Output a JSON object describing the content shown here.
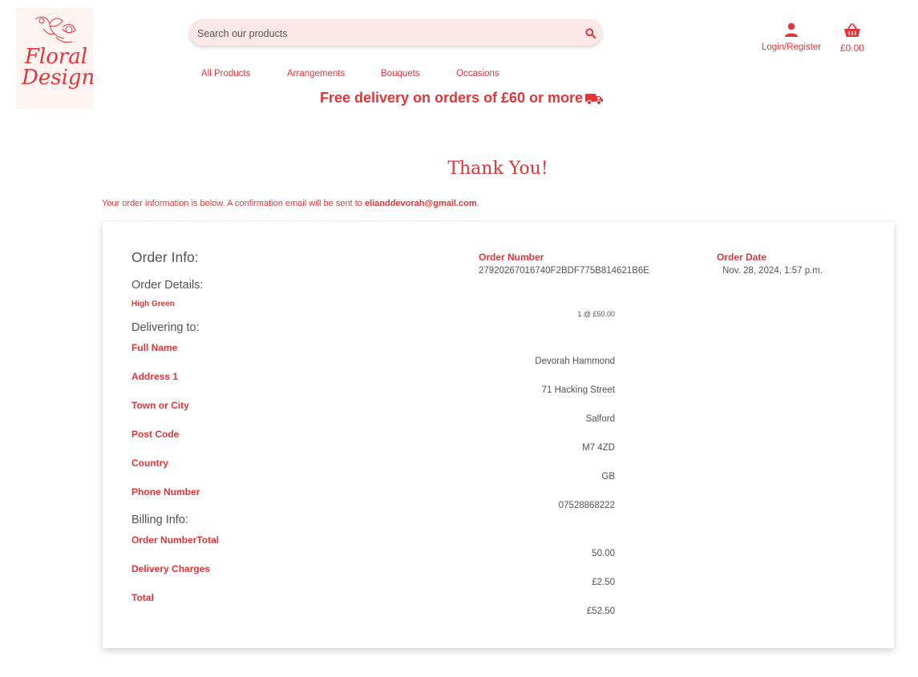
{
  "brand": {
    "logo_text_line1": "Floral",
    "logo_text_line2": "Design"
  },
  "search": {
    "placeholder": "Search our products"
  },
  "nav": {
    "items": [
      {
        "label": "All Products"
      },
      {
        "label": "Arrangements"
      },
      {
        "label": "Bouquets"
      },
      {
        "label": "Occasions"
      }
    ]
  },
  "promo": {
    "text": "Free delivery on orders of £60 or more"
  },
  "account": {
    "label": "Login/Register"
  },
  "basket": {
    "total": "£0.00"
  },
  "page": {
    "title": "Thank You!",
    "confirmation_prefix": "Your order information is below. A confirmation email will be sent to ",
    "email": "elianddevorah@gmail.com",
    "confirmation_suffix": "."
  },
  "order": {
    "heading": "Order Info:",
    "number_label": "Order Number",
    "number": "27920267016740F2BDF775B814621B6E",
    "date_label": "Order Date",
    "date": "Nov. 28, 2024, 1:57 p.m.",
    "details_heading": "Order Details:",
    "item_name": "High Green",
    "item_qty_price": "1 @ £50.00"
  },
  "delivery": {
    "heading": "Delivering to:",
    "fields": [
      {
        "label": "Full Name",
        "value": "Devorah Hammond"
      },
      {
        "label": "Address 1",
        "value": "71 Hacking Street"
      },
      {
        "label": "Town or City",
        "value": "Salford"
      },
      {
        "label": "Post Code",
        "value": "M7 4ZD"
      },
      {
        "label": "Country",
        "value": "GB"
      },
      {
        "label": "Phone Number",
        "value": "07528868222"
      }
    ]
  },
  "billing": {
    "heading": "Billing Info:",
    "fields": [
      {
        "label": "Order NumberTotal",
        "value": "50.00"
      },
      {
        "label": "Delivery Charges",
        "value": "£2.50"
      },
      {
        "label": "Total",
        "value": "£52.50"
      }
    ]
  },
  "colors": {
    "accent": "#e0363a",
    "text": "#5a5050",
    "search_bg": "#fbe7e6",
    "logo_bg": "#fdf4f2"
  },
  "icons": {
    "search": "search-icon",
    "account": "user-icon",
    "basket": "basket-icon",
    "delivery": "truck-icon",
    "logo_flower": "flower-icon"
  }
}
